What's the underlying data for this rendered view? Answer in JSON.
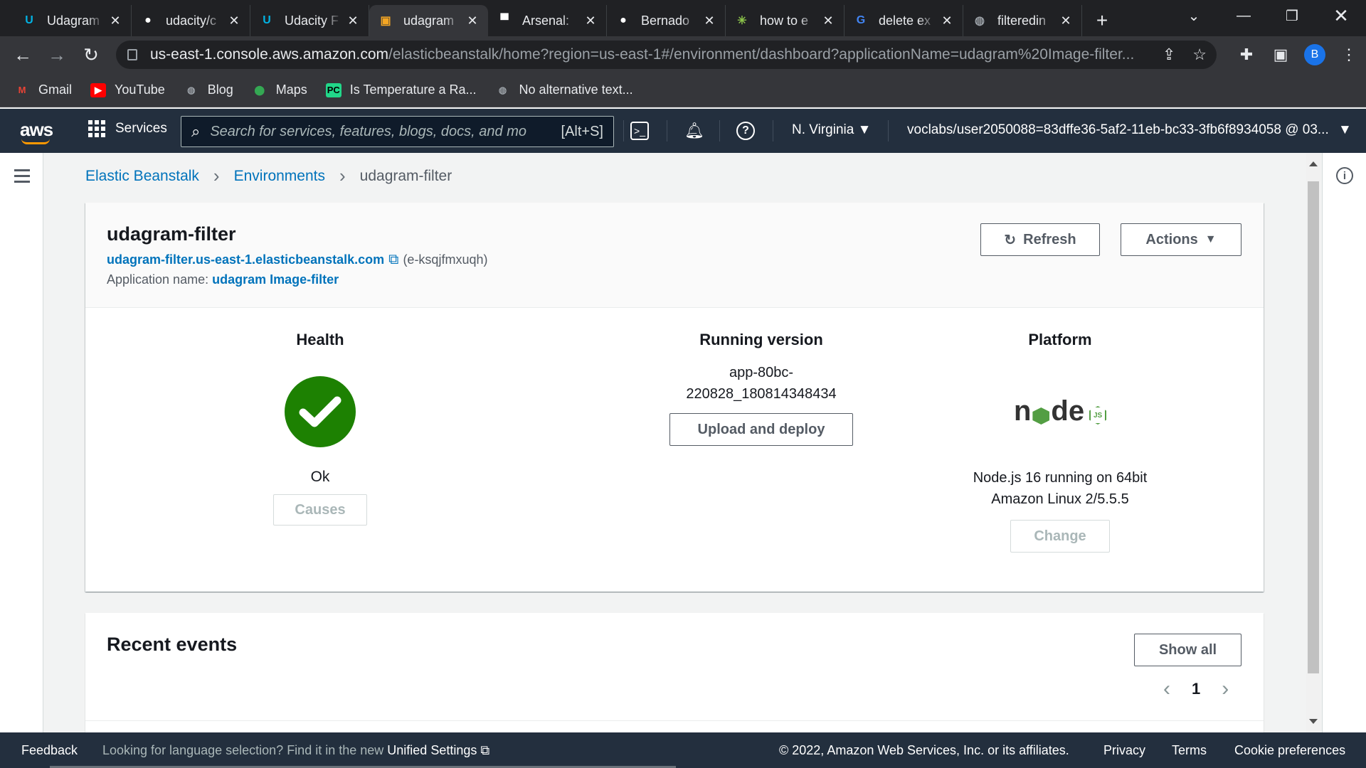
{
  "browser": {
    "tabs": [
      {
        "title": "Udagram",
        "icon": "udacity-icon",
        "color": "#02b3e4"
      },
      {
        "title": "udacity/c",
        "icon": "github-icon",
        "color": "#ffffff"
      },
      {
        "title": "Udacity F",
        "icon": "udacity-icon",
        "color": "#02b3e4"
      },
      {
        "title": "udagram",
        "icon": "aws-package-icon",
        "color": "#f5a623"
      },
      {
        "title": "Arsenal:",
        "icon": "arsenal-icon",
        "color": "#ffffff"
      },
      {
        "title": "Bernado",
        "icon": "github-icon",
        "color": "#ffffff"
      },
      {
        "title": "how to e",
        "icon": "stackexchange-icon",
        "color": "#8bc34a"
      },
      {
        "title": "delete ex",
        "icon": "google-icon",
        "color": "#4285f4"
      },
      {
        "title": "filteredin",
        "icon": "globe-icon",
        "color": "#9aa0a6"
      }
    ],
    "address": {
      "host": "us-east-1.console.aws.amazon.com",
      "path": "/elasticbeanstalk/home?region=us-east-1#/environment/dashboard?applicationName=udagram%20Image-filter..."
    },
    "profile_initial": "B",
    "bookmarks": [
      {
        "label": "Gmail",
        "icon": "gmail-icon"
      },
      {
        "label": "YouTube",
        "icon": "youtube-icon"
      },
      {
        "label": "Blog",
        "icon": "globe-icon"
      },
      {
        "label": "Maps",
        "icon": "maps-icon"
      },
      {
        "label": "Is Temperature a Ra...",
        "icon": "pycharm-icon"
      },
      {
        "label": "No alternative text...",
        "icon": "globe-icon"
      }
    ]
  },
  "aws": {
    "logo": "aws",
    "services": "Services",
    "search_placeholder": "Search for services, features, blogs, docs, and mo",
    "search_shortcut": "[Alt+S]",
    "region": "N. Virginia",
    "account": "voclabs/user2050088=83dffe36-5af2-11eb-bc33-3fb6f8934058 @ 03..."
  },
  "breadcrumb": {
    "root": "Elastic Beanstalk",
    "section": "Environments",
    "current": "udagram-filter"
  },
  "environment": {
    "name": "udagram-filter",
    "url": "udagram-filter.us-east-1.elasticbeanstalk.com",
    "env_id": "(e-ksqjfmxuqh)",
    "app_label": "Application name:",
    "app_name": "udagram Image-filter",
    "refresh": "Refresh",
    "actions": "Actions"
  },
  "health": {
    "heading": "Health",
    "status": "Ok",
    "causes": "Causes",
    "color": "#1d8102"
  },
  "running_version": {
    "heading": "Running version",
    "line1": "app-80bc-",
    "line2": "220828_180814348434",
    "upload": "Upload and deploy"
  },
  "platform": {
    "heading": "Platform",
    "logo_text": "node",
    "logo_badge": "JS",
    "line1": "Node.js 16 running on 64bit",
    "line2": "Amazon Linux 2/5.5.5",
    "change": "Change"
  },
  "recent_events": {
    "title": "Recent events",
    "show_all": "Show all",
    "page": "1"
  },
  "footer": {
    "feedback": "Feedback",
    "lang_text": "Looking for language selection? Find it in the new",
    "lang_link": "Unified Settings",
    "copyright": "© 2022, Amazon Web Services, Inc. or its affiliates.",
    "privacy": "Privacy",
    "terms": "Terms",
    "cookies": "Cookie preferences"
  }
}
